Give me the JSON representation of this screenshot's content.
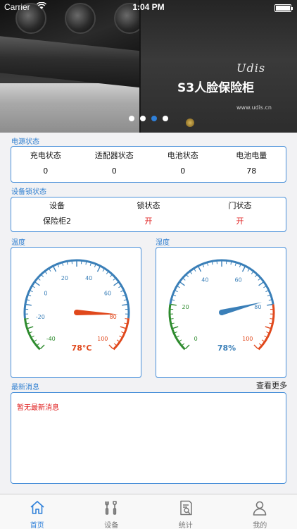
{
  "status_bar": {
    "carrier": "Carrier",
    "time": "1:04 PM",
    "battery_level": 1.0
  },
  "banner": {
    "brand": "Udis",
    "product": "S3人脸保险柜",
    "site": "www.udis.cn",
    "page_count": 4,
    "active_page": 2
  },
  "power": {
    "title": "电源状态",
    "headers": [
      "充电状态",
      "适配器状态",
      "电池状态",
      "电池电量"
    ],
    "values": [
      "0",
      "0",
      "0",
      "78"
    ]
  },
  "lock": {
    "title": "设备锁状态",
    "headers": [
      "设备",
      "锁状态",
      "门状态"
    ],
    "values": [
      "保险柜2",
      "开",
      "开"
    ],
    "alert_color": "#e02020"
  },
  "temperature": {
    "title": "温度",
    "value": 78,
    "display": "78°C",
    "min": -40,
    "max": 100,
    "tick_labels": [
      "-40",
      "-20",
      "0",
      "20",
      "40",
      "60",
      "80",
      "100"
    ],
    "needle_color": "#e0481c"
  },
  "humidity": {
    "title": "湿度",
    "value": 78,
    "display": "78%",
    "min": 0,
    "max": 100,
    "tick_labels": [
      "0",
      "20",
      "40",
      "60",
      "80",
      "100"
    ],
    "needle_color": "#3a7fb8"
  },
  "messages": {
    "title": "最新消息",
    "more_label": "查看更多",
    "empty_text": "暂无最新消息"
  },
  "tabs": [
    {
      "label": "首页",
      "icon": "home-icon",
      "active": true
    },
    {
      "label": "设备",
      "icon": "tools-icon",
      "active": false
    },
    {
      "label": "统计",
      "icon": "report-icon",
      "active": false
    },
    {
      "label": "我的",
      "icon": "person-icon",
      "active": false
    }
  ],
  "colors": {
    "accent": "#2f80d9",
    "green": "#2e8b2e",
    "blue": "#3a7fb8",
    "orange": "#e0481c"
  }
}
